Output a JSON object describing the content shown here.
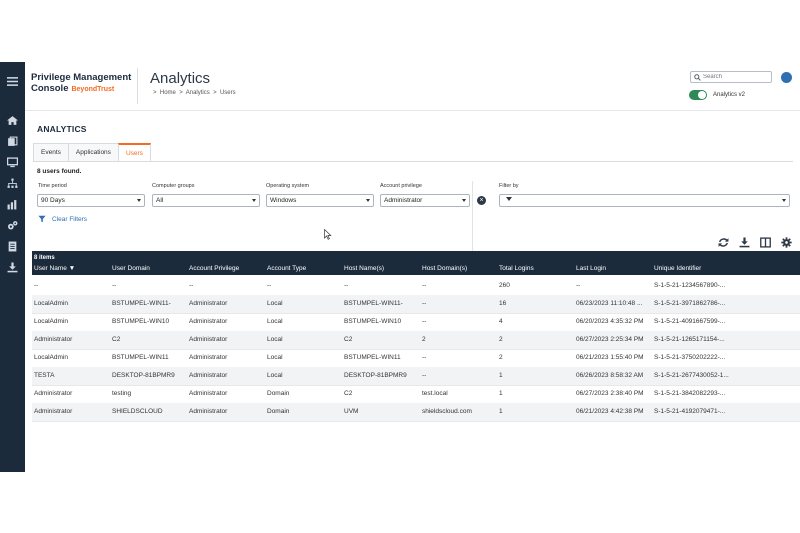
{
  "header": {
    "brand_line1": "Privilege Management",
    "brand_line2": "Console",
    "brand_logo": "BeyondTrust",
    "page_title": "Analytics",
    "breadcrumbs": [
      "Home",
      "Analytics",
      "Users"
    ],
    "breadcrumb_sep": ">",
    "search_placeholder": "Search",
    "toggle_label": "Analytics v2",
    "toggle_on": true
  },
  "sidebar": {
    "menu_icon": "hamburger-icon",
    "items": [
      "home-icon",
      "clipboard-icon",
      "monitor-icon",
      "hierarchy-icon",
      "analytics-icon",
      "gears-icon",
      "report-icon",
      "download-icon"
    ]
  },
  "main": {
    "section_title": "ANALYTICS",
    "tabs": [
      {
        "label": "Events",
        "active": false
      },
      {
        "label": "Applications",
        "active": false
      },
      {
        "label": "Users",
        "active": true
      }
    ],
    "found_text": "8 users found.",
    "filters": {
      "time_period": {
        "label": "Time period",
        "value": "90 Days"
      },
      "computer_groups": {
        "label": "Computer groups",
        "value": "All"
      },
      "operating_system": {
        "label": "Operating system",
        "value": "Windows"
      },
      "account_privilege": {
        "label": "Account privilege",
        "value": "Administrator"
      },
      "filter_by": {
        "label": "Filter by",
        "value": ""
      }
    },
    "clear_filters": "Clear Filters",
    "toolbar_icons": [
      "refresh-icon",
      "download-icon",
      "columns-icon",
      "settings-icon"
    ]
  },
  "table": {
    "items_count": "8 items",
    "columns": [
      "User Name",
      "User Domain",
      "Account Privilege",
      "Account Type",
      "Host Name(s)",
      "Host Domain(s)",
      "Total Logins",
      "Last Login",
      "Unique Identifier"
    ],
    "sort_indicator": "▼",
    "rows": [
      [
        "--",
        "--",
        "--",
        "--",
        "--",
        "--",
        "260",
        "--",
        "S-1-5-21-1234567890-..."
      ],
      [
        "LocalAdmin",
        "BSTUMPEL-WIN11-",
        "Administrator",
        "Local",
        "BSTUMPEL-WIN11-",
        "--",
        "16",
        "06/23/2023 11:10:48 ...",
        "S-1-5-21-3971862786-..."
      ],
      [
        "LocalAdmin",
        "BSTUMPEL-WIN10",
        "Administrator",
        "Local",
        "BSTUMPEL-WIN10",
        "--",
        "4",
        "06/20/2023 4:35:32 PM",
        "S-1-5-21-4091667599-..."
      ],
      [
        "Administrator",
        "C2",
        "Administrator",
        "Local",
        "C2",
        "2",
        "2",
        "06/27/2023 2:25:34 PM",
        "S-1-5-21-1265171154-..."
      ],
      [
        "LocalAdmin",
        "BSTUMPEL-WIN11",
        "Administrator",
        "Local",
        "BSTUMPEL-WIN11",
        "--",
        "2",
        "06/21/2023 1:55:40 PM",
        "S-1-5-21-3750202222-..."
      ],
      [
        "TESTA",
        "DESKTOP-81BPMR9",
        "Administrator",
        "Local",
        "DESKTOP-81BPMR9",
        "--",
        "1",
        "06/26/2023 8:58:32 AM",
        "S-1-5-21-2677430052-1..."
      ],
      [
        "Administrator",
        "testing",
        "Administrator",
        "Domain",
        "C2",
        "test.local",
        "1",
        "06/27/2023 2:38:40 PM",
        "S-1-5-21-3842082293-..."
      ],
      [
        "Administrator",
        "SHIELDSCLOUD",
        "Administrator",
        "Domain",
        "UVM",
        "shieldscloud.com",
        "1",
        "06/21/2023 4:42:38 PM",
        "S-1-5-21-4192079471-..."
      ]
    ]
  }
}
